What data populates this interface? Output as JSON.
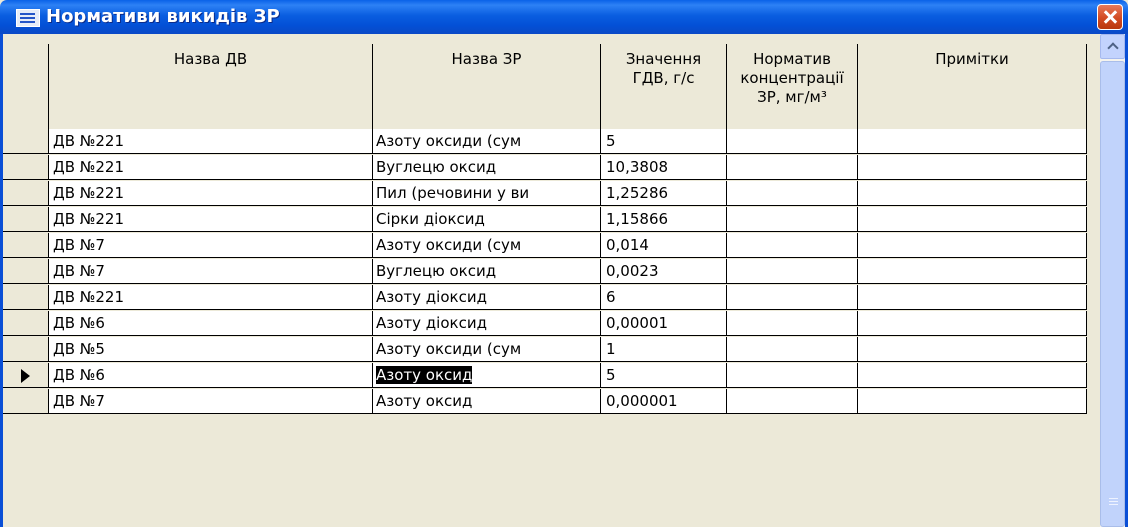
{
  "window": {
    "title": "Нормативи викидів ЗР",
    "app_icon": "table-icon",
    "close_icon": "close-icon"
  },
  "columns": [
    {
      "label_lines": [
        "Назва ДВ"
      ]
    },
    {
      "label_lines": [
        "Назва ЗР"
      ]
    },
    {
      "label_lines": [
        "Значення",
        "ГДВ, г/с"
      ]
    },
    {
      "label_lines": [
        "Норматив",
        "концентрації",
        "ЗР, мг/м³"
      ]
    },
    {
      "label_lines": [
        "Примітки"
      ]
    }
  ],
  "rows": [
    {
      "dv": "ДВ №221",
      "zr": "Азоту оксиди (сум",
      "value": "5",
      "norm": "",
      "note": ""
    },
    {
      "dv": "ДВ №221",
      "zr": "Вуглецю оксид",
      "value": "10,3808",
      "norm": "",
      "note": ""
    },
    {
      "dv": "ДВ №221",
      "zr": "Пил (речовини у ви",
      "value": "1,25286",
      "norm": "",
      "note": ""
    },
    {
      "dv": "ДВ №221",
      "zr": "Сірки діоксид",
      "value": "1,15866",
      "norm": "",
      "note": ""
    },
    {
      "dv": "ДВ №7",
      "zr": "Азоту оксиди (сум",
      "value": "0,014",
      "norm": "",
      "note": ""
    },
    {
      "dv": "ДВ №7",
      "zr": "Вуглецю оксид",
      "value": "0,0023",
      "norm": "",
      "note": ""
    },
    {
      "dv": "ДВ №221",
      "zr": "Азоту діоксид",
      "value": "6",
      "norm": "",
      "note": ""
    },
    {
      "dv": "ДВ №6",
      "zr": "Азоту діоксид",
      "value": "0,00001",
      "norm": "",
      "note": ""
    },
    {
      "dv": "ДВ №5",
      "zr": "Азоту оксиди (сум",
      "value": "1",
      "norm": "",
      "note": ""
    },
    {
      "dv": "ДВ №6",
      "zr": "Азоту оксид",
      "value": "5",
      "norm": "",
      "note": "",
      "current": true
    },
    {
      "dv": "ДВ №7",
      "zr": "Азоту оксид",
      "value": "0,000001",
      "norm": "",
      "note": ""
    }
  ]
}
